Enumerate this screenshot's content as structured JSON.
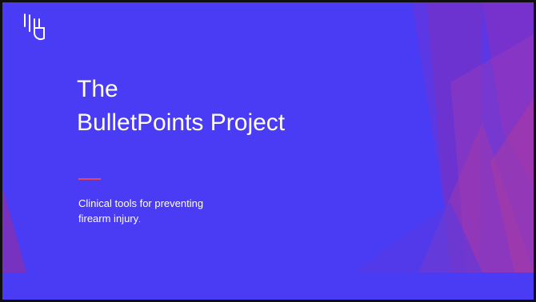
{
  "slide": {
    "title_line1": "The",
    "title_line2": "BulletPoints Project",
    "subtitle_line1": "Clinical tools for preventing",
    "subtitle_line2": "firearm injury",
    "subtitle_suffix": ".",
    "logo_icon": "hand-logo-icon"
  },
  "colors": {
    "background": "#4a3bf5",
    "accent": "#e8465a",
    "text": "#ffffff",
    "facet_purple": "#7a2fb8"
  }
}
